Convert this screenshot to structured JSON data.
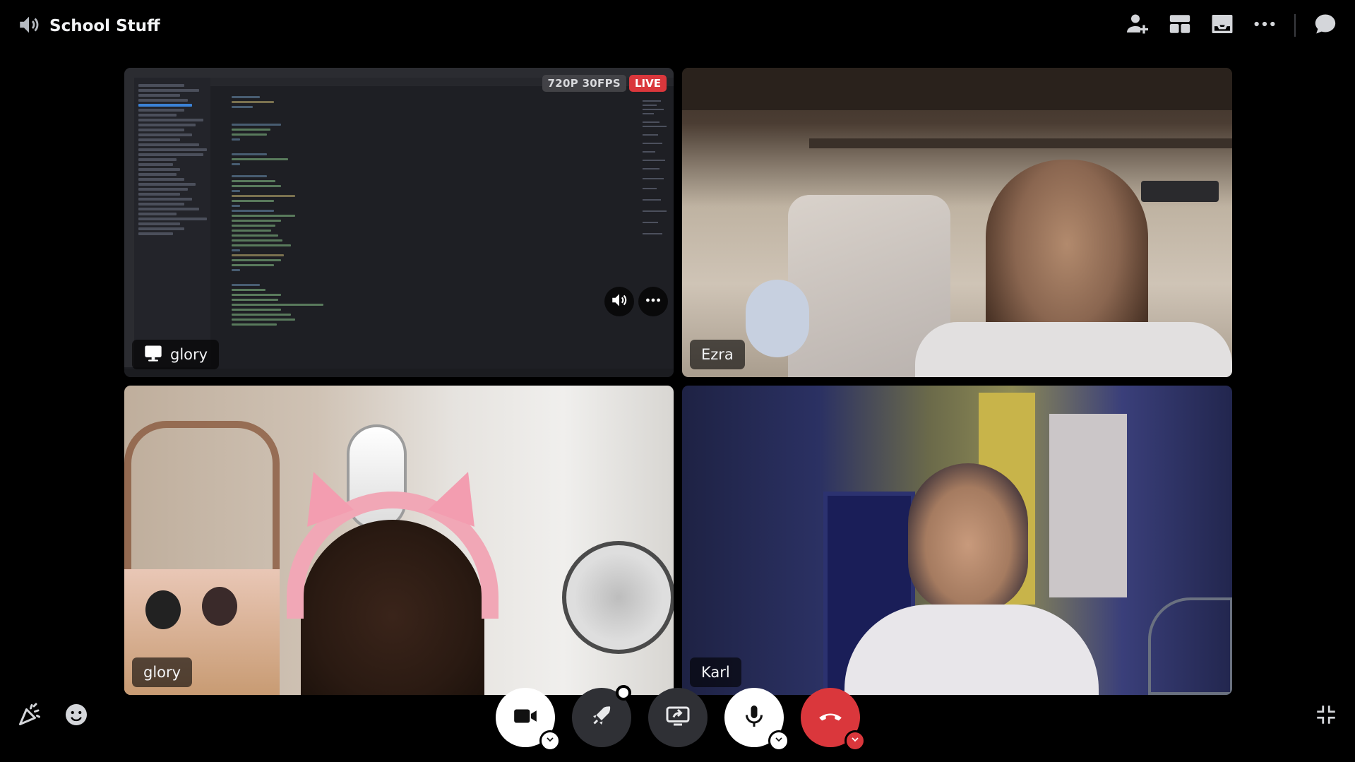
{
  "channel": {
    "title": "School Stuff",
    "icon": "speaker-icon"
  },
  "toolbar": {
    "buttons": [
      {
        "name": "add-member-button",
        "icon": "person-plus-icon"
      },
      {
        "name": "layout-button",
        "icon": "grid-layout-icon"
      },
      {
        "name": "inbox-button",
        "icon": "inbox-icon"
      },
      {
        "name": "more-options-button",
        "icon": "ellipsis-icon"
      },
      {
        "name": "chat-button",
        "icon": "chat-bubble-icon"
      }
    ]
  },
  "tiles": {
    "screen_share": {
      "participant": "glory",
      "resolution_badge": "720P 30FPS",
      "live_badge": "LIVE",
      "icon": "monitor-icon"
    },
    "ezra": {
      "participant": "Ezra"
    },
    "glory_camera": {
      "participant": "glory"
    },
    "karl": {
      "participant": "Karl"
    }
  },
  "controls": {
    "camera": {
      "icon": "video-camera-icon",
      "state": "on"
    },
    "activities": {
      "icon": "rocket-icon"
    },
    "screen_share": {
      "icon": "screen-share-icon"
    },
    "microphone": {
      "icon": "microphone-icon",
      "state": "on"
    },
    "disconnect": {
      "icon": "phone-hangup-icon"
    }
  },
  "colors": {
    "live": "#da373c",
    "control_dark": "#2f3035",
    "background": "#000000"
  }
}
